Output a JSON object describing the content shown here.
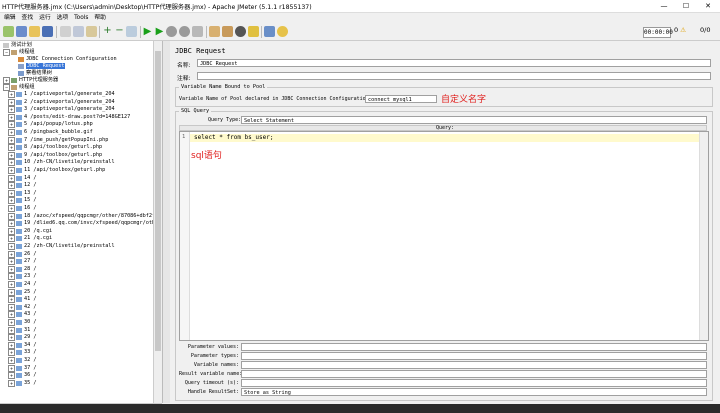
{
  "window": {
    "title": "HTTP代理服务器.jmx (C:\\Users\\admin\\Desktop\\HTTP代理服务器.jmx) - Apache JMeter (5.1.1 r1855137)",
    "minimize": "—",
    "maximize": "☐",
    "close": "✕"
  },
  "menu": [
    "编辑",
    "查找",
    "运行",
    "选项",
    "Tools",
    "帮助"
  ],
  "toolbar": {
    "timer": "00:00:00",
    "warn_count": "0",
    "ratio": "0/0",
    "icons": [
      "new-icon",
      "templates-icon",
      "open-icon",
      "save-icon",
      "cut-icon",
      "copy-icon",
      "paste-icon",
      "expand-icon",
      "collapse-icon",
      "toggle-icon",
      "start-icon",
      "start-no-pause-icon",
      "stop-icon",
      "shutdown-icon",
      "remote-start-icon",
      "clear-icon",
      "clear-all-icon",
      "search-icon",
      "reset-search-icon",
      "function-helper-icon",
      "help-icon"
    ]
  },
  "tree": {
    "root": "测试计划",
    "thread_group": "线程组",
    "jdbc_conf": "JDBC Connection Configuration",
    "jdbc_req": "JDBC Request",
    "results": "察看结果树",
    "proxy": "HTTP代理服务器",
    "thread_group2": "线程组",
    "items": [
      "1 /captiveportal/generate_204",
      "2 /captiveportal/generate_204",
      "3 /captiveportal/generate_204",
      "4 /posts/edit-draw.post?d=148GE127",
      "5 /api/popup/lotus.php",
      "6 /pingback_bubble.gif",
      "7 /ime_push/getPopupIni.php",
      "8 /api/toolbox/geturl.php",
      "9 /api/toolbox/geturl.php",
      "10 /zh-CN/livetile/preinstall",
      "11 /api/toolbox/geturl.php",
      "14 /",
      "12 /",
      "13 /",
      "15 /",
      "16 /",
      "18 /azoc/xfspeed/qqpcmgr/other/87086+dbf2ff730",
      "19 /dlied6.qq.com/invc/xfspeed/qqpcmgr/other/87",
      "20 /q.cgi",
      "21 /q.cgi",
      "22 /zh-CN/livetile/preinstall",
      "26 /",
      "27 /",
      "28 /",
      "23 /",
      "24 /",
      "25 /",
      "41 /",
      "42 /",
      "43 /",
      "30 /",
      "31 /",
      "29 /",
      "34 /",
      "33 /",
      "32 /",
      "37 /",
      "36 /",
      "35 /"
    ]
  },
  "panel": {
    "title": "JDBC Request",
    "name_label": "名称:",
    "name_value": "JDBC Request",
    "comment_label": "注释:",
    "comment_value": "",
    "varname_group": "Variable Name Bound to Pool",
    "varname_label": "Variable Name of Pool declared in JDBC Connection Configuration:",
    "varname_value": "connect_mysql1",
    "sqlquery_group": "SQL Query",
    "query_type_label": "Query Type:",
    "query_type_value": "Select Statement",
    "query_header": "Query:",
    "line_no": "1",
    "sql_code": "select * from bs_user;",
    "params": [
      {
        "label": "Parameter values:",
        "value": ""
      },
      {
        "label": "Parameter types:",
        "value": ""
      },
      {
        "label": "Variable names:",
        "value": ""
      },
      {
        "label": "Result variable name:",
        "value": ""
      },
      {
        "label": "Query timeout (s):",
        "value": ""
      },
      {
        "label": "Handle ResultSet:",
        "value": "Store as String"
      }
    ]
  },
  "annotations": {
    "custom_name": "自定义名字",
    "sql_stmt": "sql语句"
  },
  "colors": {
    "annotation": "#e0201e",
    "selection": "#3875d7",
    "highlight_line": "#fffacd"
  }
}
